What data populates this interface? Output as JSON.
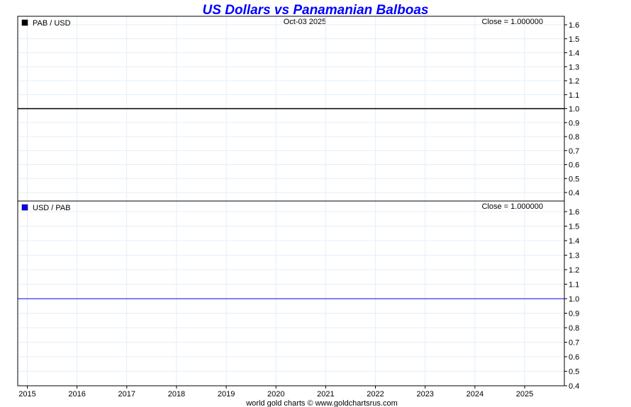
{
  "chart_data": {
    "type": "line",
    "title": "US Dollars vs Panamanian Balboas",
    "date_label": "Oct-03  2025",
    "footer": "world gold charts © www.goldchartsrus.com",
    "x_ticks": [
      "2015",
      "2016",
      "2017",
      "2018",
      "2019",
      "2020",
      "2021",
      "2022",
      "2023",
      "2024",
      "2025"
    ],
    "x_range": [
      2014.8,
      2025.8
    ],
    "grid": true,
    "panels": [
      {
        "name": "PAB / USD",
        "color": "#000000",
        "close_label": "Close = 1.000000",
        "ylim": [
          0.4,
          1.6
        ],
        "y_ticks": [
          "1.6",
          "1.5",
          "1.4",
          "1.3",
          "1.2",
          "1.1",
          "1.0",
          "0.9",
          "0.8",
          "0.7",
          "0.6",
          "0.5",
          "0.4"
        ],
        "series": {
          "x": [
            2014.8,
            2025.8
          ],
          "y": [
            1.0,
            1.0
          ]
        }
      },
      {
        "name": "USD / PAB",
        "color": "#0000ff",
        "close_label": "Close = 1.000000",
        "ylim": [
          0.4,
          1.6
        ],
        "y_ticks": [
          "1.6",
          "1.5",
          "1.4",
          "1.3",
          "1.2",
          "1.1",
          "1.0",
          "0.9",
          "0.8",
          "0.7",
          "0.6",
          "0.5",
          "0.4"
        ],
        "series": {
          "x": [
            2014.8,
            2025.8
          ],
          "y": [
            1.0,
            1.0
          ]
        }
      }
    ]
  }
}
